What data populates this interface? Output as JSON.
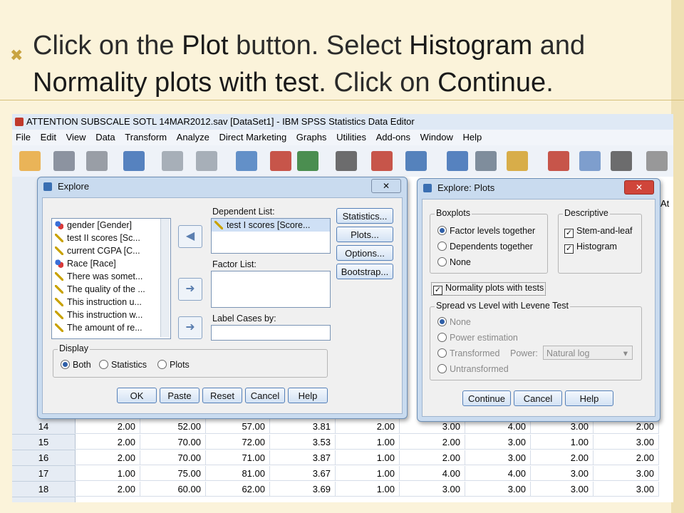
{
  "slide": {
    "line1": {
      "pre": "Click on the ",
      "plot": "Plot",
      "mid": " button. Select ",
      "hist": "Histogram",
      "post": " and"
    },
    "line2": {
      "norm": "Normality plots with test",
      "mid": ". Click on ",
      "cont": "Continue",
      "post": "."
    }
  },
  "window": {
    "title": "ATTENTION SUBSCALE SOTL 14MAR2012.sav [DataSet1] - IBM SPSS Statistics Data Editor"
  },
  "menu": [
    "File",
    "Edit",
    "View",
    "Data",
    "Transform",
    "Analyze",
    "Direct Marketing",
    "Graphs",
    "Utilities",
    "Add-ons",
    "Window",
    "Help"
  ],
  "toolbar_icons": [
    "open-folder-icon",
    "save-icon",
    "print-icon",
    "recall-dialog-icon",
    "undo-icon",
    "redo-icon",
    "goto-case-icon",
    "goto-variable-icon",
    "variables-icon",
    "find-icon",
    "insert-cases-icon",
    "insert-variable-icon",
    "split-file-icon",
    "weight-cases-icon",
    "select-cases-icon",
    "value-labels-icon",
    "use-sets-icon",
    "show-all-icon",
    "spelling-icon"
  ],
  "explore": {
    "title": "Explore",
    "variables": [
      {
        "icon": "nominal",
        "label": "gender [Gender]"
      },
      {
        "icon": "scale",
        "label": "test II scores [Sc..."
      },
      {
        "icon": "scale",
        "label": "current CGPA [C..."
      },
      {
        "icon": "nominal",
        "label": "Race [Race]"
      },
      {
        "icon": "scale",
        "label": "There was somet..."
      },
      {
        "icon": "scale",
        "label": "The quality of the ..."
      },
      {
        "icon": "scale",
        "label": "This instruction u..."
      },
      {
        "icon": "scale",
        "label": "This instruction w..."
      },
      {
        "icon": "scale",
        "label": "The amount of re..."
      }
    ],
    "dependent_label": "Dependent List:",
    "dependent_items": [
      "test I scores [Score..."
    ],
    "factor_label": "Factor List:",
    "label_cases": "Label Cases by:",
    "buttons": {
      "statistics": "Statistics...",
      "plots": "Plots...",
      "options": "Options...",
      "bootstrap": "Bootstrap..."
    },
    "display": {
      "label": "Display",
      "both": "Both",
      "statistics": "Statistics",
      "plots": "Plots"
    },
    "bottom": {
      "ok": "OK",
      "paste": "Paste",
      "reset": "Reset",
      "cancel": "Cancel",
      "help": "Help"
    }
  },
  "plots": {
    "title": "Explore: Plots",
    "boxplots": {
      "label": "Boxplots",
      "factor": "Factor levels together",
      "dependents": "Dependents together",
      "none": "None"
    },
    "descriptive": {
      "label": "Descriptive",
      "stem": "Stem-and-leaf",
      "hist": "Histogram"
    },
    "normality": "Normality plots with tests",
    "spread": {
      "label": "Spread vs Level with Levene Test",
      "none": "None",
      "power": "Power estimation",
      "transformed": "Transformed",
      "power_label": "Power:",
      "power_value": "Natural log",
      "untransformed": "Untransformed"
    },
    "bottom": {
      "continue": "Continue",
      "cancel": "Cancel",
      "help": "Help"
    }
  },
  "grid": {
    "partial_header": "At",
    "rows": [
      {
        "n": "14",
        "v": [
          "2.00",
          "52.00",
          "57.00",
          "3.81",
          "2.00",
          "3.00",
          "4.00",
          "3.00",
          "2.00"
        ]
      },
      {
        "n": "15",
        "v": [
          "2.00",
          "70.00",
          "72.00",
          "3.53",
          "1.00",
          "2.00",
          "3.00",
          "1.00",
          "3.00"
        ]
      },
      {
        "n": "16",
        "v": [
          "2.00",
          "70.00",
          "71.00",
          "3.87",
          "1.00",
          "2.00",
          "3.00",
          "2.00",
          "2.00"
        ]
      },
      {
        "n": "17",
        "v": [
          "1.00",
          "75.00",
          "81.00",
          "3.67",
          "1.00",
          "4.00",
          "4.00",
          "3.00",
          "3.00"
        ]
      },
      {
        "n": "18",
        "v": [
          "2.00",
          "60.00",
          "62.00",
          "3.69",
          "1.00",
          "3.00",
          "3.00",
          "3.00",
          "3.00"
        ]
      }
    ]
  }
}
